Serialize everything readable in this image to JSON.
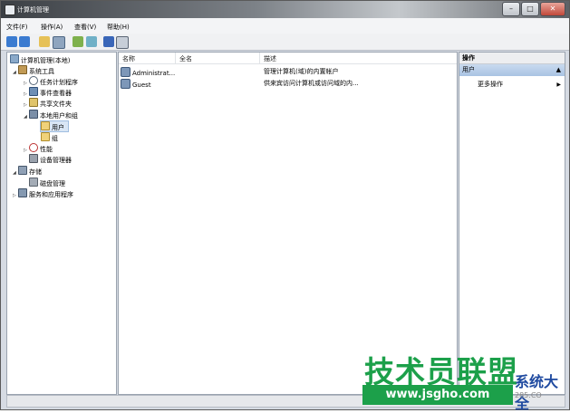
{
  "window": {
    "title": "计算机管理",
    "buttons": {
      "minimize": "–",
      "maximize": "□",
      "close": "✕"
    }
  },
  "menubar": {
    "items": [
      "文件(F)",
      "操作(A)",
      "查看(V)",
      "帮助(H)"
    ]
  },
  "toolbar": {
    "icons": [
      "back-icon",
      "forward-icon",
      "up-icon",
      "show-hide-tree-icon",
      "refresh-icon",
      "export-icon",
      "help-icon",
      "properties-icon"
    ]
  },
  "tree": {
    "root": "计算机管理(本地)",
    "items": [
      {
        "label": "系统工具",
        "icon": "tools-icon"
      },
      {
        "label": "任务计划程序",
        "icon": "task-scheduler-icon"
      },
      {
        "label": "事件查看器",
        "icon": "event-viewer-icon"
      },
      {
        "label": "共享文件夹",
        "icon": "shared-folders-icon"
      },
      {
        "label": "本地用户和组",
        "icon": "local-users-icon"
      },
      {
        "label": "用户",
        "icon": "folder-icon"
      },
      {
        "label": "组",
        "icon": "folder-icon"
      },
      {
        "label": "性能",
        "icon": "performance-icon"
      },
      {
        "label": "设备管理器",
        "icon": "device-manager-icon"
      },
      {
        "label": "存储",
        "icon": "storage-icon"
      },
      {
        "label": "磁盘管理",
        "icon": "disk-icon"
      },
      {
        "label": "服务和应用程序",
        "icon": "services-icon"
      }
    ]
  },
  "list": {
    "columns": [
      "名称",
      "全名",
      "描述"
    ],
    "rows": [
      {
        "name": "Administrat...",
        "fullname": "",
        "description": "管理计算机(域)的内置帐户"
      },
      {
        "name": "Guest",
        "fullname": "",
        "description": "供来宾访问计算机或访问域的内..."
      }
    ]
  },
  "actions": {
    "title": "操作",
    "section": "用户",
    "item": "更多操作"
  },
  "watermark": {
    "main": "技术员联盟",
    "url": "www.jsgho.com",
    "side": "系统大全",
    "tail": "285.CO"
  },
  "colors": {
    "titlebar": "#5d6166",
    "selection": "#d9e6f5",
    "watermark_green": "#1ca04a"
  }
}
